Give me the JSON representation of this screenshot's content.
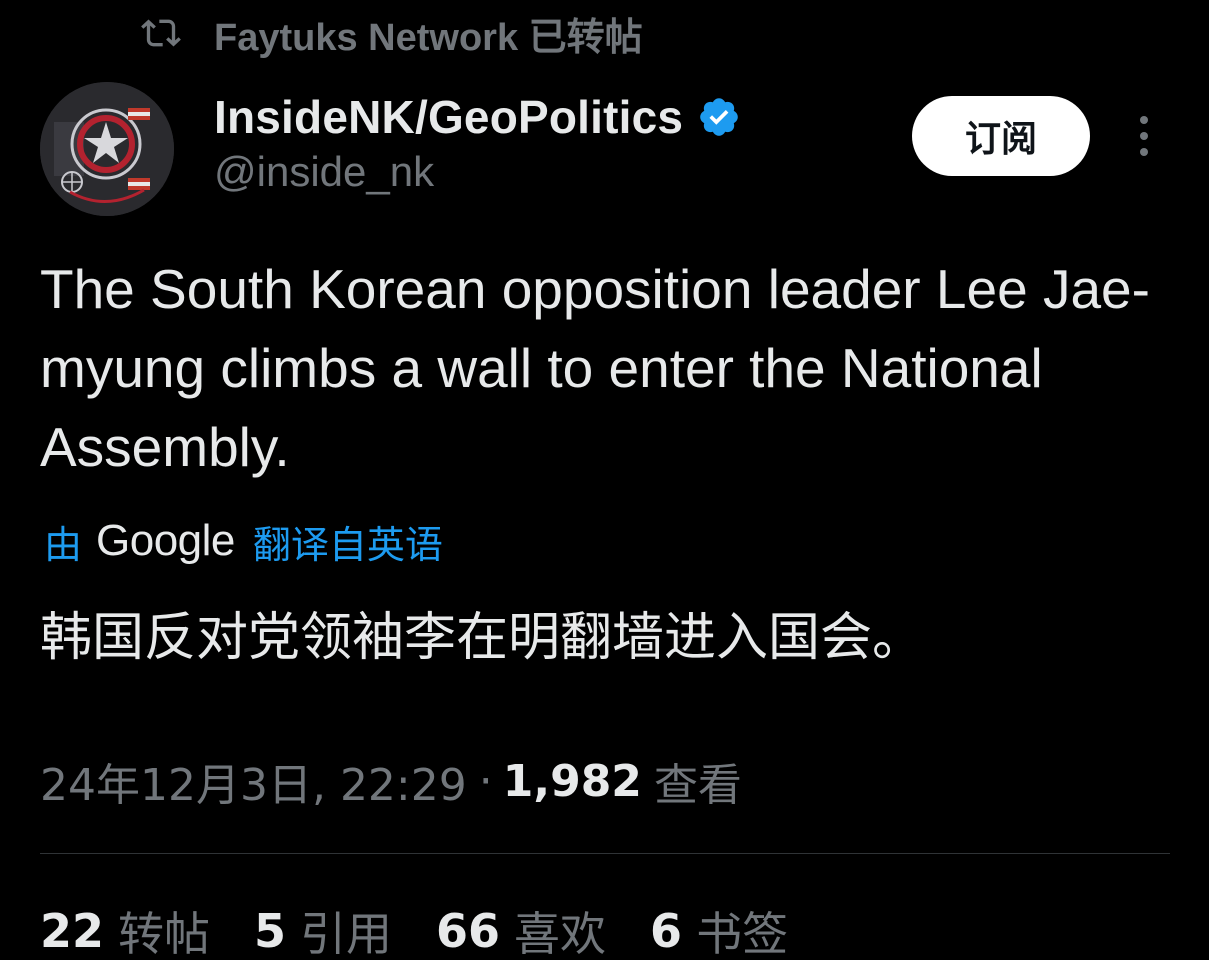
{
  "repost": {
    "icon": "repost-icon",
    "text": "Faytuks Network 已转帖"
  },
  "author": {
    "display_name": "InsideNK/GeoPolitics",
    "handle": "@inside_nk",
    "verified_icon": "verified-badge-icon",
    "avatar_icon": "avatar-image"
  },
  "actions": {
    "subscribe_label": "订阅",
    "more_icon": "more-icon"
  },
  "tweet": {
    "text": "The South Korean opposition leader Lee Jae-myung climbs a wall to enter the National Assembly."
  },
  "translation": {
    "by": "由",
    "provider": "Google",
    "from": "翻译自英语",
    "text": "韩国反对党领袖李在明翻墙进入国会。"
  },
  "meta": {
    "timestamp": "24年12月3日, 22:29",
    "separator": "·",
    "views_count": "1,982",
    "views_label": "查看"
  },
  "stats": [
    {
      "count": "22",
      "label": "转帖"
    },
    {
      "count": "5",
      "label": "引用"
    },
    {
      "count": "66",
      "label": "喜欢"
    },
    {
      "count": "6",
      "label": "书签"
    }
  ],
  "colors": {
    "background": "#000000",
    "text_primary": "#e7e9ea",
    "text_secondary": "#71767b",
    "accent": "#1d9bf0",
    "divider": "#2f3336"
  }
}
